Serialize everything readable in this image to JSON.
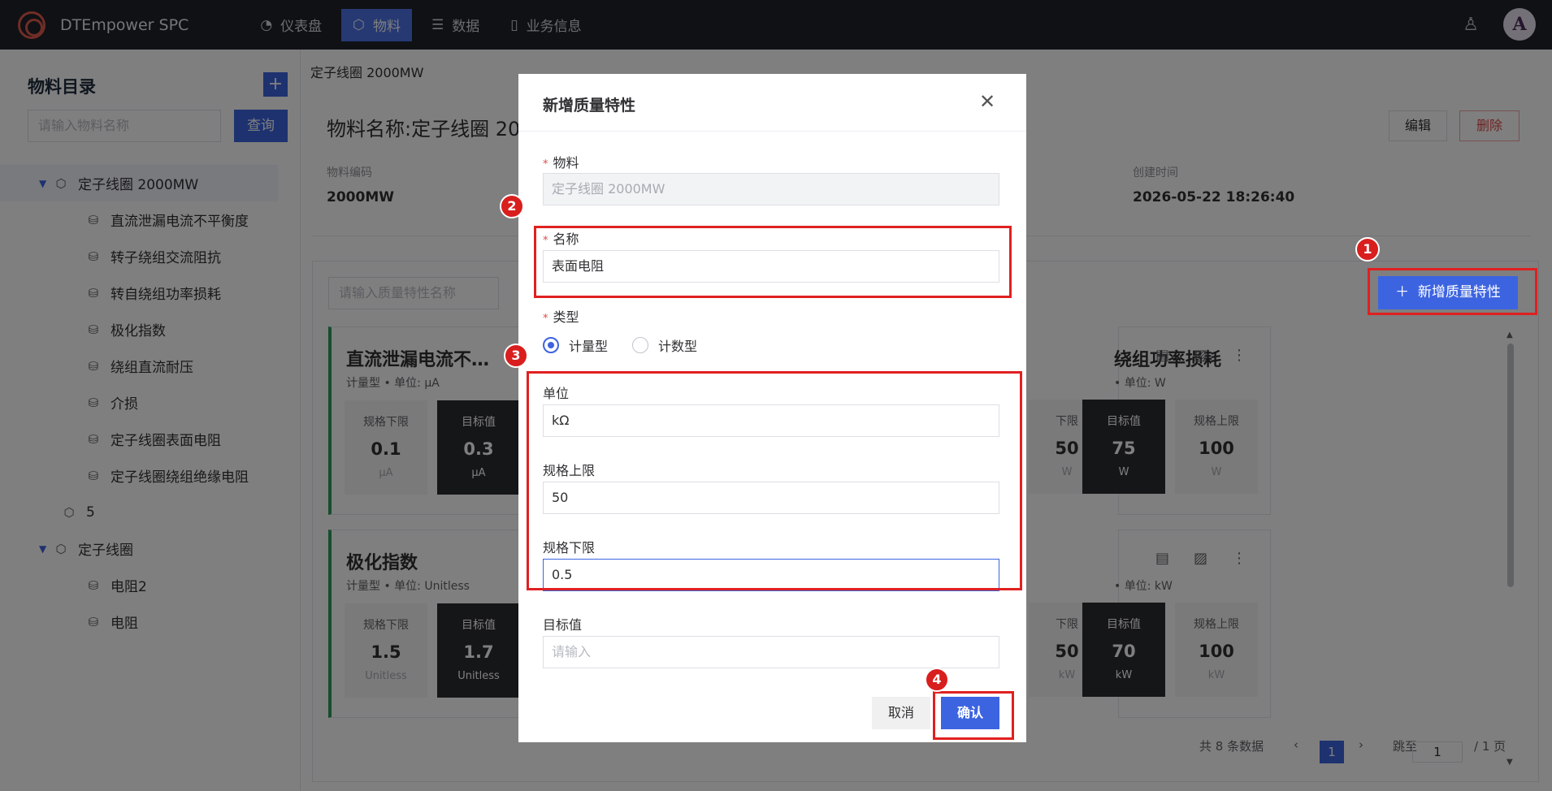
{
  "app": {
    "brand": "DTEmpower SPC",
    "avatar_letter": "A"
  },
  "nav": [
    {
      "label": "仪表盘",
      "icon": "dashboard-icon",
      "active": false
    },
    {
      "label": "物料",
      "icon": "material-icon",
      "active": true
    },
    {
      "label": "数据",
      "icon": "data-icon",
      "active": false
    },
    {
      "label": "业务信息",
      "icon": "document-icon",
      "active": false
    }
  ],
  "sidebar": {
    "title": "物料目录",
    "search_placeholder": "请输入物料名称",
    "query_label": "查询",
    "tree": [
      {
        "label": "定子线圈 2000MW",
        "level": 0,
        "expanded": true,
        "selected": true
      },
      {
        "label": "直流泄漏电流不平衡度",
        "level": 1
      },
      {
        "label": "转子绕组交流阻抗",
        "level": 1
      },
      {
        "label": "转自绕组功率损耗",
        "level": 1
      },
      {
        "label": "极化指数",
        "level": 1
      },
      {
        "label": "绕组直流耐压",
        "level": 1
      },
      {
        "label": "介损",
        "level": 1
      },
      {
        "label": "定子线圈表面电阻",
        "level": 1
      },
      {
        "label": "定子线圈绕组绝缘电阻",
        "level": 1
      },
      {
        "label": "5",
        "level": 0
      },
      {
        "label": "定子线圈",
        "level": 0,
        "expanded": true
      },
      {
        "label": "电阻2",
        "level": 1
      },
      {
        "label": "电阻",
        "level": 1
      }
    ]
  },
  "main": {
    "breadcrumb": "定子线圈 2000MW",
    "title": "物料名称:定子线圈 20",
    "edit_label": "编辑",
    "delete_label": "删除",
    "meta": {
      "code_label": "物料编码",
      "code_value": "2000MW",
      "created_label": "创建时间",
      "created_value": "2026-05-22 18:26:40"
    },
    "qc_search_placeholder": "请输入质量特性名称",
    "add_qc_label": "新增质量特性",
    "cards": [
      {
        "name": "直流泄漏电流不…",
        "sub": "计量型 • 单位: µA",
        "lower_label": "规格下限",
        "lower": "0.1",
        "target_label": "目标值",
        "target": "0.3",
        "unit": "µA"
      },
      {
        "name": "绕组功率损耗",
        "sub": "• 单位: W",
        "lower_label": "下限",
        "lower": "50",
        "target_label": "目标值",
        "target": "75",
        "upper_label": "规格上限",
        "upper": "100",
        "unit": "W"
      },
      {
        "name": "极化指数",
        "sub": "计量型 • 单位: Unitless",
        "lower_label": "规格下限",
        "lower": "1.5",
        "target_label": "目标值",
        "target": "1.7",
        "unit": "Unitless"
      },
      {
        "name": "",
        "sub": "• 单位: kW",
        "lower_label": "下限",
        "lower": "50",
        "target_label": "目标值",
        "target": "70",
        "upper_label": "规格上限",
        "upper": "100",
        "unit": "kW"
      }
    ],
    "pager": {
      "total": "共 8 条数据",
      "page": "1",
      "jump_label": "跳至",
      "jump_value": "1",
      "pages": "/ 1 页"
    }
  },
  "dialog": {
    "title": "新增质量特性",
    "material_label": "物料",
    "material_value": "定子线圈 2000MW",
    "name_label": "名称",
    "name_value": "表面电阻",
    "type_label": "类型",
    "type_option_1": "计量型",
    "type_option_2": "计数型",
    "unit_label": "单位",
    "unit_value": "kΩ",
    "upper_label": "规格上限",
    "upper_value": "50",
    "lower_label": "规格下限",
    "lower_value": "0.5",
    "target_label": "目标值",
    "target_placeholder": "请输入",
    "cancel_label": "取消",
    "ok_label": "确认"
  },
  "annotations": [
    "1",
    "2",
    "3",
    "4"
  ]
}
